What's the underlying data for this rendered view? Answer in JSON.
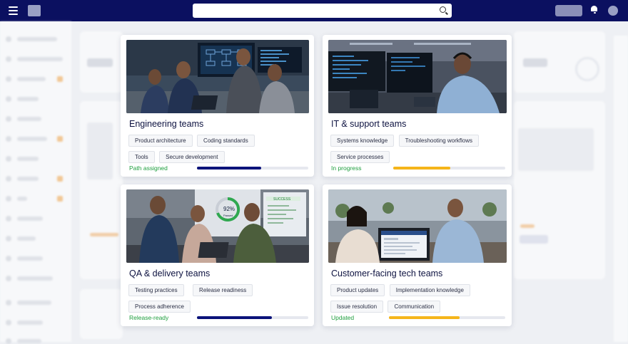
{
  "colors": {
    "topbar": "#0b1060",
    "status_green": "#1e9e3e",
    "progress_navy": "#0b137a",
    "progress_amber": "#f5b51a"
  },
  "icons": [
    "menu-icon",
    "search-icon",
    "bell-icon"
  ],
  "cards": [
    {
      "title": "Engineering teams",
      "tags": [
        "Product architecture",
        "Coding standards",
        "Tools",
        "Secure development"
      ],
      "status": "Path assigned",
      "progress": 0.58,
      "bar_color": "#0b137a"
    },
    {
      "title": "IT & support teams",
      "tags": [
        "Systems knowledge",
        "Troubleshooting workflows",
        "Service processes"
      ],
      "status": "In progress",
      "progress": 0.51,
      "bar_color": "#f5b51a"
    },
    {
      "title": "QA & delivery teams",
      "tags": [
        "Testing practices",
        "Release readiness",
        "Process adherence"
      ],
      "status": "Release-ready",
      "progress": 0.67,
      "bar_color": "#0b137a",
      "photo_text": {
        "percent": "92%",
        "passed": "Passed",
        "success": "SUCCESS"
      }
    },
    {
      "title": "Customer-facing tech teams",
      "tags": [
        "Product updates",
        "Implementation knowledge",
        "Issue resolution",
        "Communication"
      ],
      "status": "Updated",
      "progress": 0.61,
      "bar_color": "#f5b51a"
    }
  ]
}
